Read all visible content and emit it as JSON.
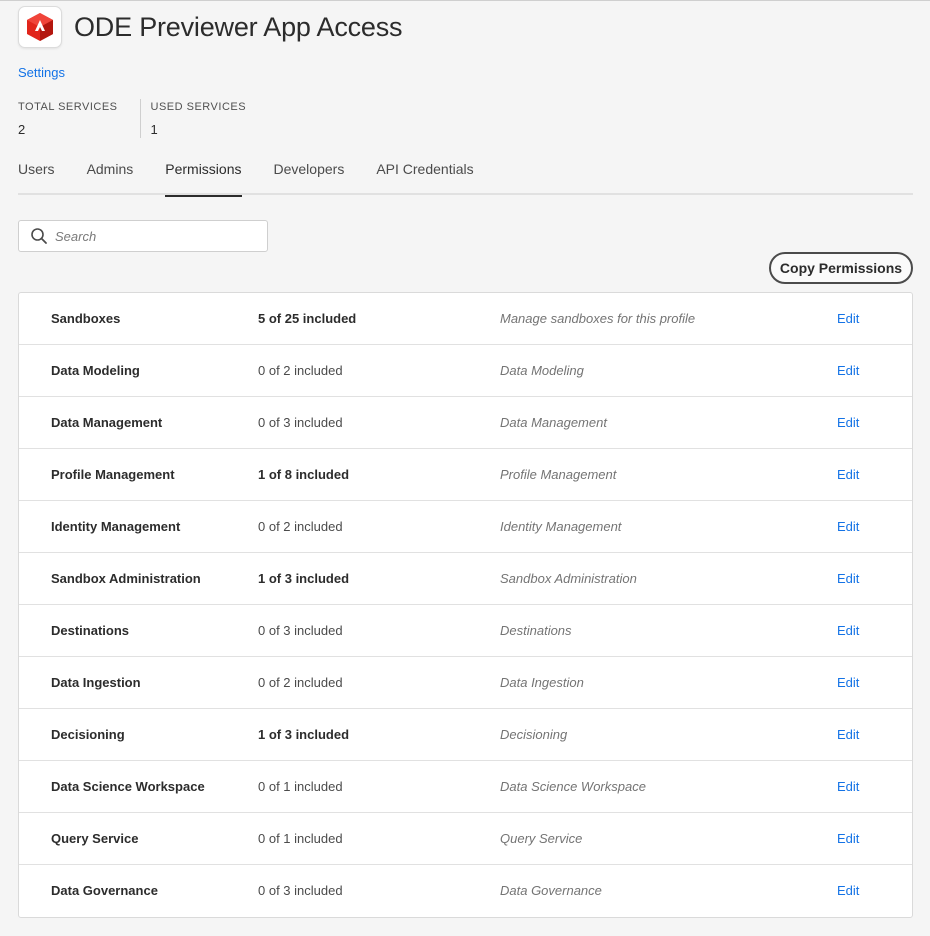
{
  "header": {
    "title": "ODE Previewer App Access",
    "icon": "adobe-experience-platform-icon"
  },
  "settings_link": "Settings",
  "stats": [
    {
      "label": "TOTAL SERVICES",
      "value": "2"
    },
    {
      "label": "USED SERVICES",
      "value": "1"
    }
  ],
  "tabs": [
    {
      "label": "Users",
      "active": false
    },
    {
      "label": "Admins",
      "active": false
    },
    {
      "label": "Permissions",
      "active": true
    },
    {
      "label": "Developers",
      "active": false
    },
    {
      "label": "API Credentials",
      "active": false
    }
  ],
  "search": {
    "placeholder": "Search",
    "value": ""
  },
  "copy_button": "Copy Permissions",
  "permissions": [
    {
      "name": "Sandboxes",
      "count": "5 of 25 included",
      "emphasis": true,
      "description": "Manage sandboxes for this profile",
      "action": "Edit"
    },
    {
      "name": "Data Modeling",
      "count": "0 of 2 included",
      "emphasis": false,
      "description": "Data Modeling",
      "action": "Edit"
    },
    {
      "name": "Data Management",
      "count": "0 of 3 included",
      "emphasis": false,
      "description": "Data Management",
      "action": "Edit"
    },
    {
      "name": "Profile Management",
      "count": "1 of 8 included",
      "emphasis": true,
      "description": "Profile Management",
      "action": "Edit"
    },
    {
      "name": "Identity Management",
      "count": "0 of 2 included",
      "emphasis": false,
      "description": "Identity Management",
      "action": "Edit"
    },
    {
      "name": "Sandbox Administration",
      "count": "1 of 3 included",
      "emphasis": true,
      "description": "Sandbox Administration",
      "action": "Edit"
    },
    {
      "name": "Destinations",
      "count": "0 of 3 included",
      "emphasis": false,
      "description": "Destinations",
      "action": "Edit"
    },
    {
      "name": "Data Ingestion",
      "count": "0 of 2 included",
      "emphasis": false,
      "description": "Data Ingestion",
      "action": "Edit"
    },
    {
      "name": "Decisioning",
      "count": "1 of 3 included",
      "emphasis": true,
      "description": "Decisioning",
      "action": "Edit"
    },
    {
      "name": "Data Science Workspace",
      "count": "0 of 1 included",
      "emphasis": false,
      "description": "Data Science Workspace",
      "action": "Edit"
    },
    {
      "name": "Query Service",
      "count": "0 of 1 included",
      "emphasis": false,
      "description": "Query Service",
      "action": "Edit"
    },
    {
      "name": "Data Governance",
      "count": "0 of 3 included",
      "emphasis": false,
      "description": "Data Governance",
      "action": "Edit"
    }
  ],
  "colors": {
    "link": "#1473e6",
    "brand_red": "#e1251b"
  }
}
